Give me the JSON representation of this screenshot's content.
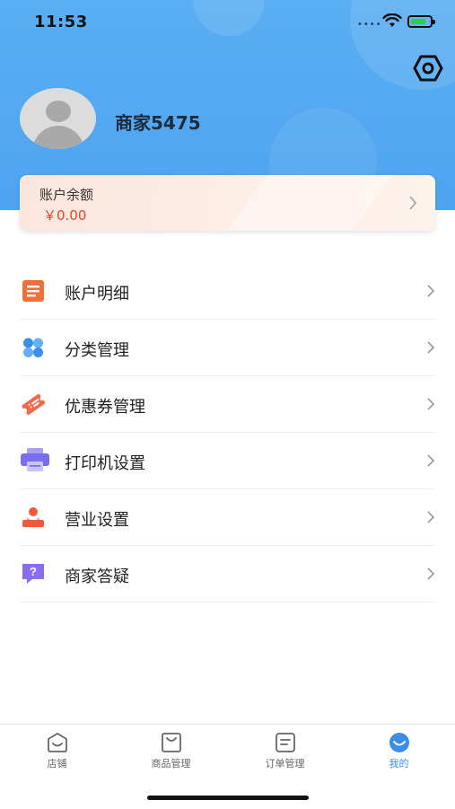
{
  "status_bar": {
    "time": "11:53"
  },
  "header": {
    "merchant_name": "商家5475"
  },
  "balance_card": {
    "title": "账户余额",
    "amount": "￥0.00"
  },
  "menu": {
    "items": [
      {
        "label": "账户明细",
        "icon": "document-list-icon",
        "color": "#f0703a"
      },
      {
        "label": "分类管理",
        "icon": "category-grid-icon",
        "color": "#3a8fe8"
      },
      {
        "label": "优惠券管理",
        "icon": "coupon-icon",
        "color": "#f06a4a"
      },
      {
        "label": "打印机设置",
        "icon": "printer-icon",
        "color": "#7b6cf0"
      },
      {
        "label": "营业设置",
        "icon": "business-icon",
        "color": "#f05a3a"
      },
      {
        "label": "商家答疑",
        "icon": "question-chat-icon",
        "color": "#8a6cf0"
      }
    ]
  },
  "tab_bar": {
    "tabs": [
      {
        "label": "店铺",
        "icon": "shop-icon"
      },
      {
        "label": "商品管理",
        "icon": "bag-icon"
      },
      {
        "label": "订单管理",
        "icon": "order-icon"
      },
      {
        "label": "我的",
        "icon": "profile-smile-icon",
        "active": true
      }
    ]
  },
  "colors": {
    "header_blue": "#4ea4ef",
    "accent_blue": "#3a8ee6",
    "amount_red": "#e0452c"
  }
}
